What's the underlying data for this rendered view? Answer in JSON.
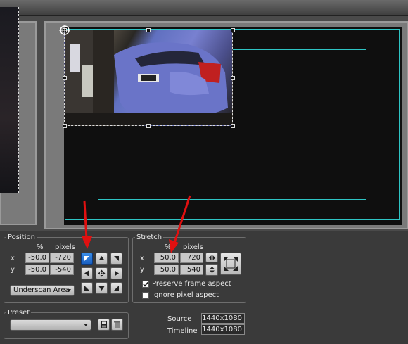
{
  "position": {
    "title": "Position",
    "col_percent": "%",
    "col_pixels": "pixels",
    "x_label": "x",
    "y_label": "y",
    "x_percent": "-50.0",
    "x_pixels": "-720",
    "y_percent": "-50.0",
    "y_pixels": "-540",
    "area_dropdown": "Underscan Area",
    "anchor_grid_icons": [
      "anchor-top-left-icon",
      "anchor-top-icon",
      "anchor-top-right-icon",
      "anchor-left-icon",
      "anchor-center-icon",
      "anchor-right-icon",
      "anchor-bottom-left-icon",
      "anchor-bottom-icon",
      "anchor-bottom-right-icon"
    ]
  },
  "stretch": {
    "title": "Stretch",
    "col_percent": "%",
    "col_pixels": "pixels",
    "x_label": "x",
    "y_label": "y",
    "x_percent": "50.0",
    "x_pixels": "720",
    "y_percent": "50.0",
    "y_pixels": "540",
    "preserve_frame_aspect": "Preserve frame aspect",
    "preserve_frame_aspect_checked": true,
    "ignore_pixel_aspect": "Ignore pixel aspect",
    "ignore_pixel_aspect_checked": false
  },
  "preset": {
    "title": "Preset",
    "value": "",
    "icons": [
      "save-preset-icon",
      "delete-preset-icon"
    ]
  },
  "info": {
    "source_label": "Source",
    "source_value": "1440x1080",
    "timeline_label": "Timeline",
    "timeline_value": "1440x1080"
  },
  "colors": {
    "safe_area": "#2ec4c4",
    "annotation_arrow": "#e01010",
    "active_button": "#1a5fc0"
  }
}
